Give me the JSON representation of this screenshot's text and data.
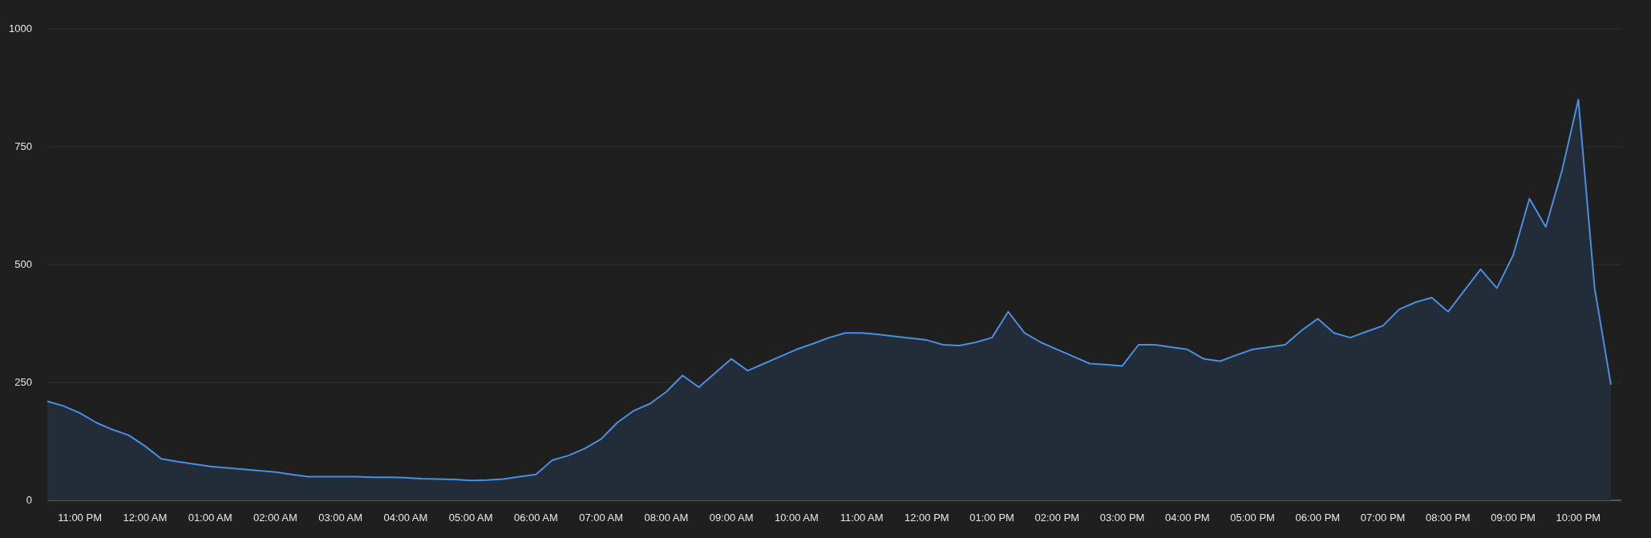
{
  "chart": {
    "chart_data": {
      "type": "area",
      "categories": [
        null,
        null,
        "11:00 PM",
        null,
        null,
        null,
        "12:00 AM",
        null,
        null,
        null,
        "01:00 AM",
        null,
        null,
        null,
        "02:00 AM",
        null,
        null,
        null,
        "03:00 AM",
        null,
        null,
        null,
        "04:00 AM",
        null,
        null,
        null,
        "05:00 AM",
        null,
        null,
        null,
        "06:00 AM",
        null,
        null,
        null,
        "07:00 AM",
        null,
        null,
        null,
        "08:00 AM",
        null,
        null,
        null,
        "09:00 AM",
        null,
        null,
        null,
        "10:00 AM",
        null,
        null,
        null,
        "11:00 AM",
        null,
        null,
        null,
        "12:00 PM",
        null,
        null,
        null,
        "01:00 PM",
        null,
        null,
        null,
        "02:00 PM",
        null,
        null,
        null,
        "03:00 PM",
        null,
        null,
        null,
        "04:00 PM",
        null,
        null,
        null,
        "05:00 PM",
        null,
        null,
        null,
        "06:00 PM",
        null,
        null,
        null,
        "07:00 PM",
        null,
        null,
        null,
        "08:00 PM",
        null,
        null,
        null,
        "09:00 PM",
        null,
        null,
        null,
        "10:00 PM",
        null,
        null
      ],
      "series": [
        {
          "color": "#4a8fe0",
          "values": [
            210,
            200,
            185,
            165,
            150,
            138,
            115,
            88,
            82,
            77,
            72,
            69,
            66,
            63,
            60,
            55,
            50,
            50,
            50,
            50,
            49,
            49,
            48,
            46,
            45,
            44,
            42,
            43,
            45,
            50,
            55,
            85,
            95,
            110,
            130,
            165,
            190,
            205,
            230,
            265,
            240,
            270,
            300,
            275,
            290,
            305,
            320,
            332,
            345,
            355,
            355,
            352,
            348,
            344,
            340,
            330,
            328,
            335,
            345,
            400,
            355,
            335,
            320,
            305,
            290,
            288,
            285,
            330,
            330,
            325,
            320,
            300,
            295,
            308,
            320,
            325,
            330,
            360,
            385,
            355,
            345,
            358,
            370,
            405,
            420,
            430,
            400,
            445,
            490,
            450,
            520,
            640,
            580,
            700,
            850,
            450,
            245
          ]
        }
      ],
      "grid": true,
      "ylim": [
        0,
        1000
      ],
      "yticks": [
        0,
        250,
        500,
        750,
        1000
      ]
    }
  }
}
